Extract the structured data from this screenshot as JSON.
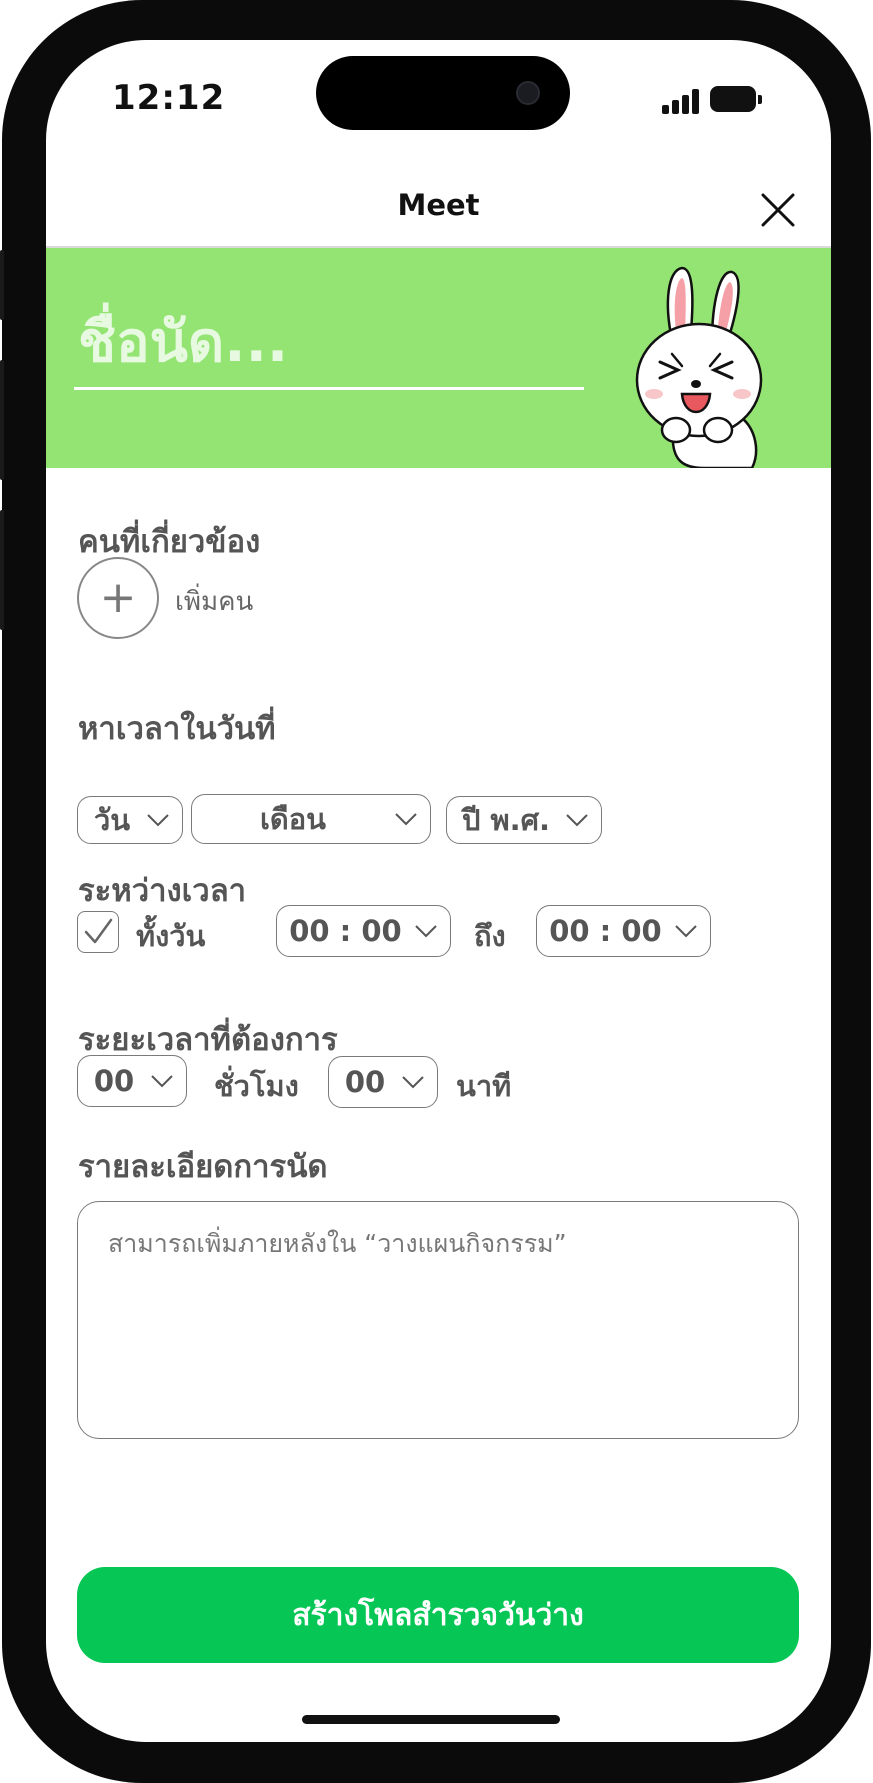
{
  "status_bar": {
    "time": "12:12"
  },
  "header": {
    "title": "Meet",
    "close_icon": "close-icon"
  },
  "banner": {
    "name_placeholder": "ชื่อนัด...",
    "color": "#93e472"
  },
  "participants": {
    "label": "คนที่เกี่ยวข้อง",
    "add_label": "เพิ่มคน"
  },
  "date": {
    "label": "หาเวลาในวันที่",
    "day": "วัน",
    "month": "เดือน",
    "year": "ปี พ.ศ."
  },
  "time_range": {
    "label": "ระหว่างเวลา",
    "all_day_label": "ทั้งวัน",
    "all_day_checked": true,
    "from": "00 : 00",
    "to_label": "ถึง",
    "to": "00 : 00"
  },
  "duration": {
    "label": "ระยะเวลาที่ต้องการ",
    "hours": "00",
    "hours_label": "ชั่วโมง",
    "minutes": "00",
    "minutes_label": "นาที"
  },
  "details": {
    "label": "รายละเอียดการนัด",
    "placeholder": "สามารถเพิ่มภายหลังใน “วางแผนกิจกรรม”"
  },
  "cta": {
    "label": "สร้างโพลสำรวจวันว่าง",
    "color": "#06c755"
  }
}
